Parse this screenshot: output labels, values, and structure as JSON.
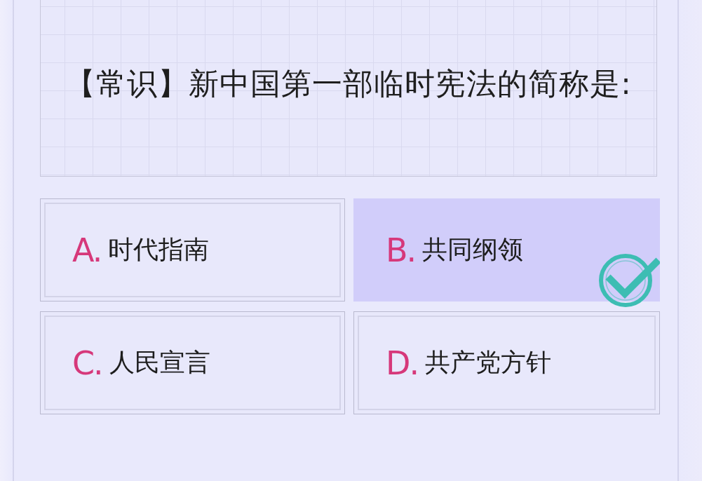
{
  "question": {
    "text": "【常识】新中国第一部临时宪法的简称是:"
  },
  "options": [
    {
      "letter": "A.",
      "text": "时代指南",
      "selected": false
    },
    {
      "letter": "B.",
      "text": "共同纲领",
      "selected": true
    },
    {
      "letter": "C.",
      "text": "人民宣言",
      "selected": false
    },
    {
      "letter": "D.",
      "text": "共产党方针",
      "selected": false
    }
  ]
}
